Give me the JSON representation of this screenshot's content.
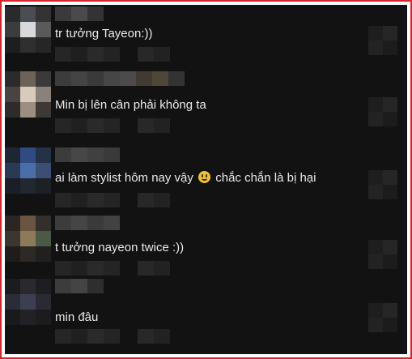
{
  "comments": [
    {
      "text": "tr tưởng Tayeon:))"
    },
    {
      "text": "Min bị lên cân phải không ta"
    },
    {
      "text_before": "ai làm stylist hôm nay vậy",
      "emoji": "grinning-face-emoji",
      "text_after": "chắc chắn là bị hại"
    },
    {
      "text": "t tưởng nayeon twice :))"
    },
    {
      "text": "min đâu"
    }
  ],
  "colors": {
    "border": "#d8232a",
    "background": "#121212",
    "text": "#e9e9e9"
  }
}
